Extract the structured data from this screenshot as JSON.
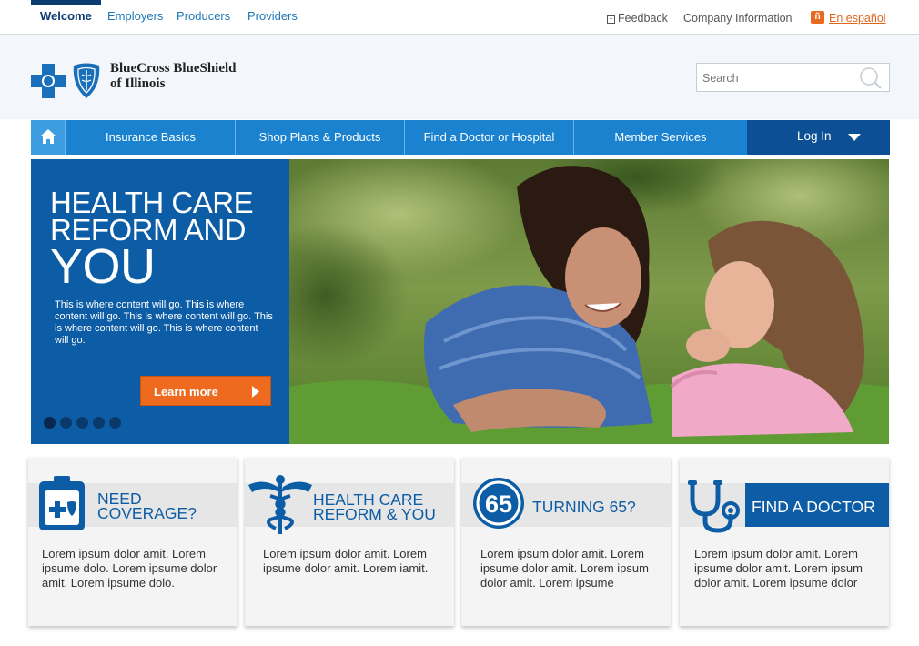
{
  "top_tabs": [
    {
      "label": "Welcome",
      "active": true
    },
    {
      "label": "Employers",
      "active": false
    },
    {
      "label": "Producers",
      "active": false
    },
    {
      "label": "Providers",
      "active": false
    }
  ],
  "utility": {
    "feedback": "Feedback",
    "company_info": "Company Information",
    "espanol": "En español"
  },
  "brand": {
    "line1": "BlueCross BlueShield",
    "line2": "of Illinois"
  },
  "search": {
    "placeholder": "Search"
  },
  "nav": {
    "items": [
      "Insurance Basics",
      "Shop Plans & Products",
      "Find a Doctor or Hospital",
      "Member Services"
    ],
    "login": "Log In"
  },
  "hero": {
    "title_line1": "HEALTH CARE",
    "title_line2": "REFORM AND",
    "title_line3": "YOU",
    "body": "This is where content will go. This is where content will go. This is where content will go. This is where content will go. This is where content will go.",
    "button": "Learn more",
    "slide_count": 5,
    "active_slide": 1
  },
  "cards": [
    {
      "title1": "NEED",
      "title2": "COVERAGE?",
      "body": "Lorem ipsum dolor amit. Lorem ipsume dolo. Lorem ipsume dolor amit. Lorem ipsume dolo."
    },
    {
      "title1": "HEALTH CARE",
      "title2": "REFORM & YOU",
      "body": "Lorem ipsum dolor amit. Lorem ipsume dolor amit. Lorem iamit."
    },
    {
      "title1": "TURNING 65?",
      "badge": "65",
      "body": "Lorem ipsum dolor amit. Lorem ipsume dolor amit. Lorem ipsum dolor amit. Lorem ipsume"
    },
    {
      "title1": "FIND A DOCTOR",
      "body": "Lorem ipsum dolor amit. Lorem ipsume dolor amit. Lorem ipsum dolor amit. Lorem ipsume dolor"
    }
  ],
  "colors": {
    "brand_blue": "#0d5da6",
    "nav_blue": "#1a82cf",
    "login_blue": "#0c4f94",
    "accent_orange": "#ee6a1e"
  }
}
